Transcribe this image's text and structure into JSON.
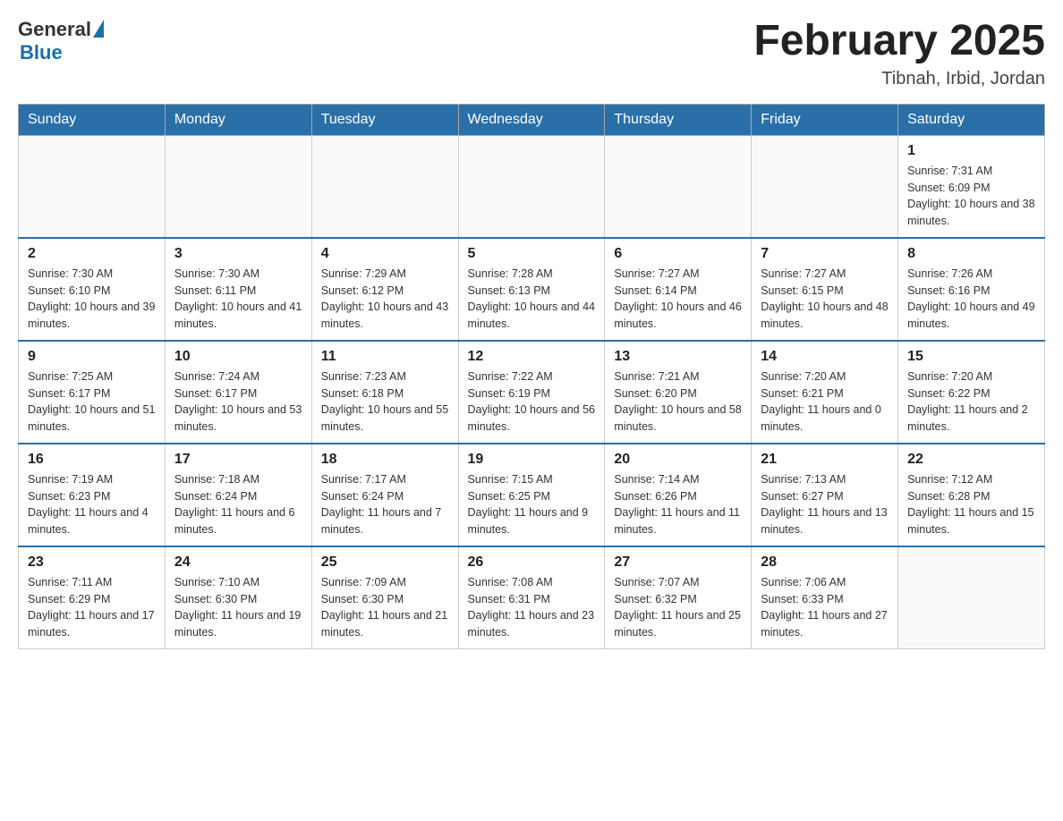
{
  "header": {
    "logo_general": "General",
    "logo_blue": "Blue",
    "month_title": "February 2025",
    "location": "Tibnah, Irbid, Jordan"
  },
  "days_of_week": [
    "Sunday",
    "Monday",
    "Tuesday",
    "Wednesday",
    "Thursday",
    "Friday",
    "Saturday"
  ],
  "weeks": [
    [
      null,
      null,
      null,
      null,
      null,
      null,
      {
        "day": "1",
        "sunrise": "Sunrise: 7:31 AM",
        "sunset": "Sunset: 6:09 PM",
        "daylight": "Daylight: 10 hours and 38 minutes."
      }
    ],
    [
      {
        "day": "2",
        "sunrise": "Sunrise: 7:30 AM",
        "sunset": "Sunset: 6:10 PM",
        "daylight": "Daylight: 10 hours and 39 minutes."
      },
      {
        "day": "3",
        "sunrise": "Sunrise: 7:30 AM",
        "sunset": "Sunset: 6:11 PM",
        "daylight": "Daylight: 10 hours and 41 minutes."
      },
      {
        "day": "4",
        "sunrise": "Sunrise: 7:29 AM",
        "sunset": "Sunset: 6:12 PM",
        "daylight": "Daylight: 10 hours and 43 minutes."
      },
      {
        "day": "5",
        "sunrise": "Sunrise: 7:28 AM",
        "sunset": "Sunset: 6:13 PM",
        "daylight": "Daylight: 10 hours and 44 minutes."
      },
      {
        "day": "6",
        "sunrise": "Sunrise: 7:27 AM",
        "sunset": "Sunset: 6:14 PM",
        "daylight": "Daylight: 10 hours and 46 minutes."
      },
      {
        "day": "7",
        "sunrise": "Sunrise: 7:27 AM",
        "sunset": "Sunset: 6:15 PM",
        "daylight": "Daylight: 10 hours and 48 minutes."
      },
      {
        "day": "8",
        "sunrise": "Sunrise: 7:26 AM",
        "sunset": "Sunset: 6:16 PM",
        "daylight": "Daylight: 10 hours and 49 minutes."
      }
    ],
    [
      {
        "day": "9",
        "sunrise": "Sunrise: 7:25 AM",
        "sunset": "Sunset: 6:17 PM",
        "daylight": "Daylight: 10 hours and 51 minutes."
      },
      {
        "day": "10",
        "sunrise": "Sunrise: 7:24 AM",
        "sunset": "Sunset: 6:17 PM",
        "daylight": "Daylight: 10 hours and 53 minutes."
      },
      {
        "day": "11",
        "sunrise": "Sunrise: 7:23 AM",
        "sunset": "Sunset: 6:18 PM",
        "daylight": "Daylight: 10 hours and 55 minutes."
      },
      {
        "day": "12",
        "sunrise": "Sunrise: 7:22 AM",
        "sunset": "Sunset: 6:19 PM",
        "daylight": "Daylight: 10 hours and 56 minutes."
      },
      {
        "day": "13",
        "sunrise": "Sunrise: 7:21 AM",
        "sunset": "Sunset: 6:20 PM",
        "daylight": "Daylight: 10 hours and 58 minutes."
      },
      {
        "day": "14",
        "sunrise": "Sunrise: 7:20 AM",
        "sunset": "Sunset: 6:21 PM",
        "daylight": "Daylight: 11 hours and 0 minutes."
      },
      {
        "day": "15",
        "sunrise": "Sunrise: 7:20 AM",
        "sunset": "Sunset: 6:22 PM",
        "daylight": "Daylight: 11 hours and 2 minutes."
      }
    ],
    [
      {
        "day": "16",
        "sunrise": "Sunrise: 7:19 AM",
        "sunset": "Sunset: 6:23 PM",
        "daylight": "Daylight: 11 hours and 4 minutes."
      },
      {
        "day": "17",
        "sunrise": "Sunrise: 7:18 AM",
        "sunset": "Sunset: 6:24 PM",
        "daylight": "Daylight: 11 hours and 6 minutes."
      },
      {
        "day": "18",
        "sunrise": "Sunrise: 7:17 AM",
        "sunset": "Sunset: 6:24 PM",
        "daylight": "Daylight: 11 hours and 7 minutes."
      },
      {
        "day": "19",
        "sunrise": "Sunrise: 7:15 AM",
        "sunset": "Sunset: 6:25 PM",
        "daylight": "Daylight: 11 hours and 9 minutes."
      },
      {
        "day": "20",
        "sunrise": "Sunrise: 7:14 AM",
        "sunset": "Sunset: 6:26 PM",
        "daylight": "Daylight: 11 hours and 11 minutes."
      },
      {
        "day": "21",
        "sunrise": "Sunrise: 7:13 AM",
        "sunset": "Sunset: 6:27 PM",
        "daylight": "Daylight: 11 hours and 13 minutes."
      },
      {
        "day": "22",
        "sunrise": "Sunrise: 7:12 AM",
        "sunset": "Sunset: 6:28 PM",
        "daylight": "Daylight: 11 hours and 15 minutes."
      }
    ],
    [
      {
        "day": "23",
        "sunrise": "Sunrise: 7:11 AM",
        "sunset": "Sunset: 6:29 PM",
        "daylight": "Daylight: 11 hours and 17 minutes."
      },
      {
        "day": "24",
        "sunrise": "Sunrise: 7:10 AM",
        "sunset": "Sunset: 6:30 PM",
        "daylight": "Daylight: 11 hours and 19 minutes."
      },
      {
        "day": "25",
        "sunrise": "Sunrise: 7:09 AM",
        "sunset": "Sunset: 6:30 PM",
        "daylight": "Daylight: 11 hours and 21 minutes."
      },
      {
        "day": "26",
        "sunrise": "Sunrise: 7:08 AM",
        "sunset": "Sunset: 6:31 PM",
        "daylight": "Daylight: 11 hours and 23 minutes."
      },
      {
        "day": "27",
        "sunrise": "Sunrise: 7:07 AM",
        "sunset": "Sunset: 6:32 PM",
        "daylight": "Daylight: 11 hours and 25 minutes."
      },
      {
        "day": "28",
        "sunrise": "Sunrise: 7:06 AM",
        "sunset": "Sunset: 6:33 PM",
        "daylight": "Daylight: 11 hours and 27 minutes."
      },
      null
    ]
  ]
}
